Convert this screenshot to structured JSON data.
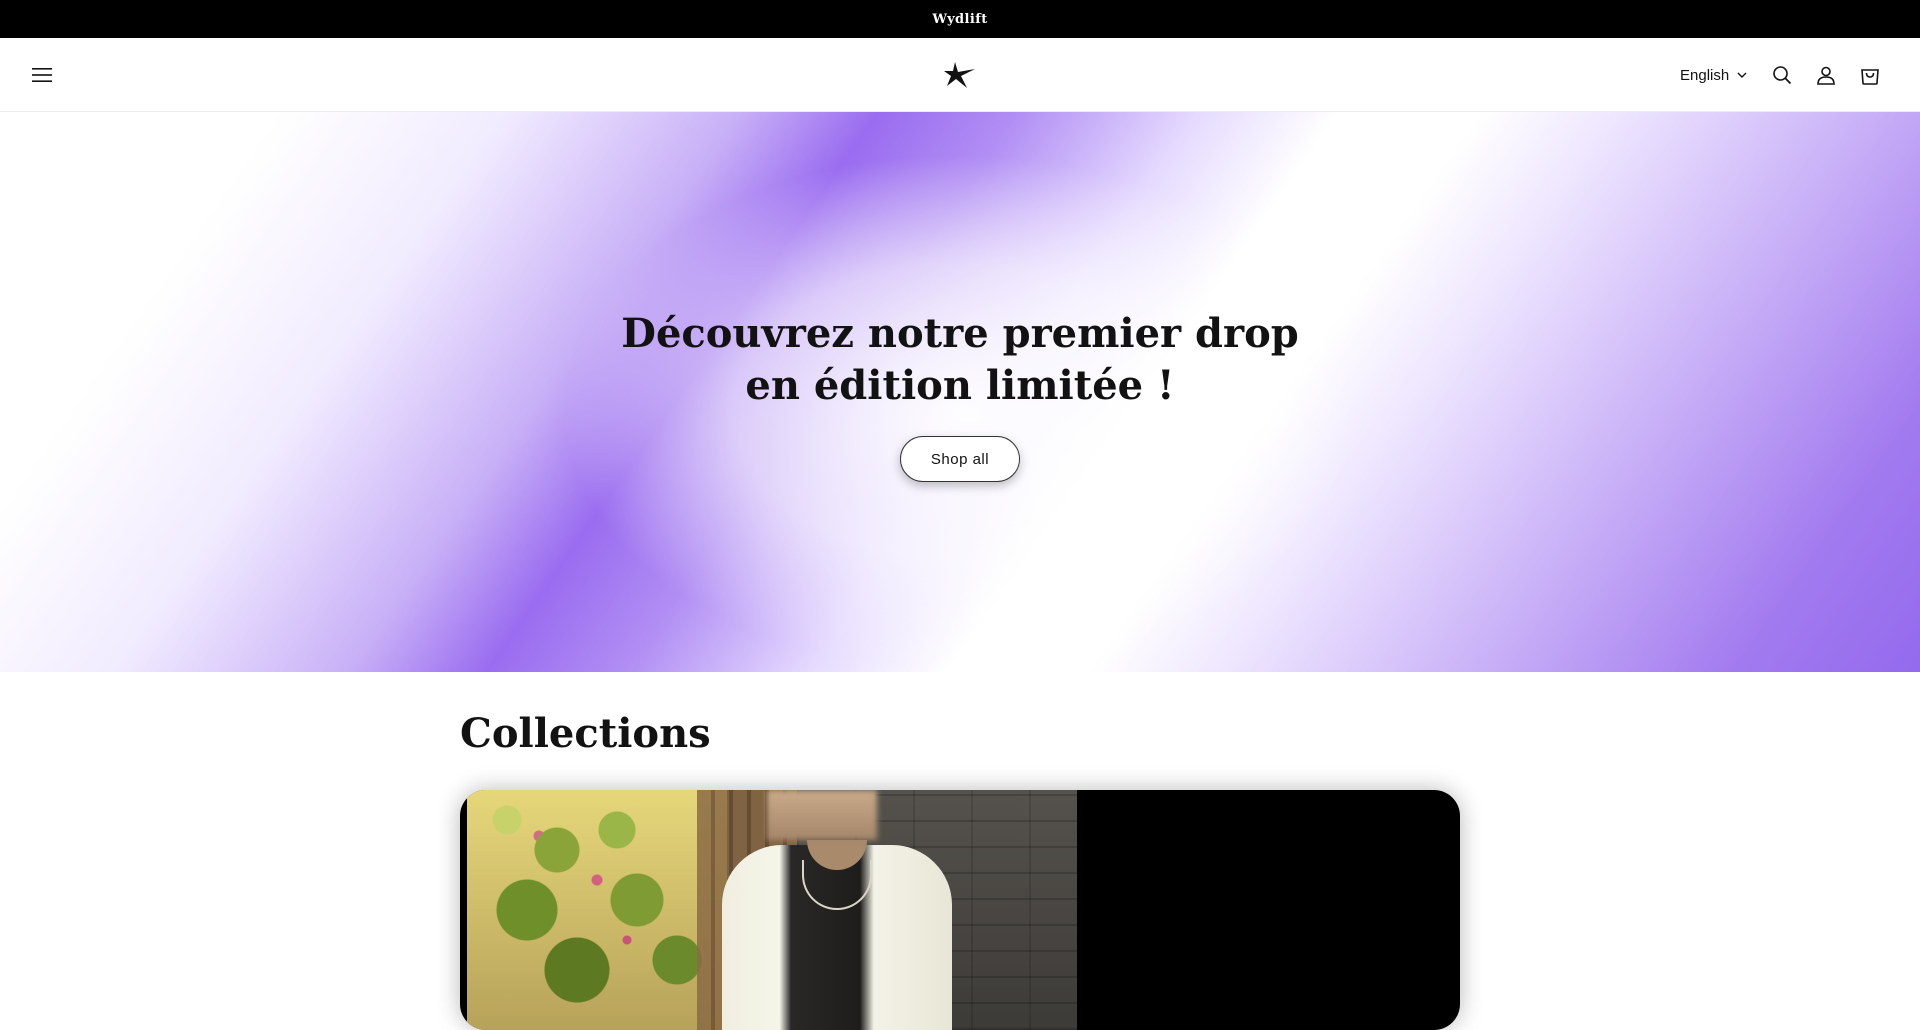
{
  "announcement": {
    "text": "Wydlift"
  },
  "header": {
    "menu_icon": "hamburger-menu-icon",
    "logo_icon": "star-logo-icon",
    "language": {
      "selected": "English",
      "icon": "chevron-down-icon"
    },
    "icons": [
      "search-icon",
      "account-icon",
      "cart-icon"
    ]
  },
  "hero": {
    "title": "Découvrez notre premier drop en édition limitée !",
    "button_label": "Shop all",
    "gradient_colors": [
      "#ffffff",
      "#9a6cf0",
      "#946aee"
    ]
  },
  "collections": {
    "title": "Collections"
  }
}
